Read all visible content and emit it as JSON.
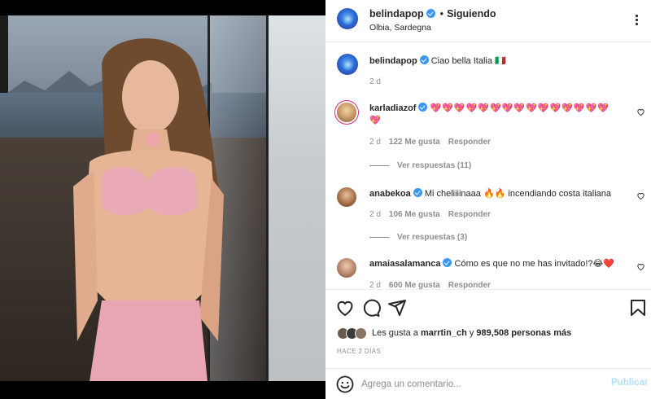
{
  "post": {
    "author": "belindapop",
    "follow_dot": "•",
    "follow_label": "Siguiendo",
    "location": "Olbia, Sardegna",
    "more_icon": "more-options-icon"
  },
  "caption": {
    "username": "belindapop",
    "text": "Ciao bella Italia",
    "emoji": "🇮🇹",
    "time": "2 d"
  },
  "comments": [
    {
      "username": "karladiazof",
      "text": "💖💖💖💖💖💖💖💖💖💖💖💖💖💖💖",
      "text_line2": "💖",
      "time": "2 d",
      "likes": "122 Me gusta",
      "reply": "Responder",
      "replies": "Ver respuestas (11)"
    },
    {
      "username": "anabekoa",
      "text": "Mi cheliiiinaaa 🔥🔥 incendiando costa italiana",
      "time": "2 d",
      "likes": "106 Me gusta",
      "reply": "Responder",
      "replies": "Ver respuestas (3)"
    },
    {
      "username": "amaiasalamanca",
      "text": "Cómo es que no me has invitado!?😂❤️",
      "time": "2 d",
      "likes": "600 Me gusta",
      "reply": "Responder"
    }
  ],
  "actions": {
    "like_icon": "heart-icon",
    "comment_icon": "comment-icon",
    "share_icon": "share-icon",
    "save_icon": "bookmark-icon"
  },
  "likes": {
    "prefix": "Les gusta a",
    "user": "marrtin_ch",
    "middle": "y",
    "count": "989,508 personas más"
  },
  "time_ago": "HACE 2 DÍAS",
  "comment_box": {
    "emoji_icon": "emoji-icon",
    "placeholder": "Agrega un comentario...",
    "publish_label": "Publicar"
  },
  "colors": {
    "verified": "#3897f0",
    "link_disabled": "#b2dffc",
    "muted": "#8e8e8e",
    "heart_red": "#ed4956"
  }
}
